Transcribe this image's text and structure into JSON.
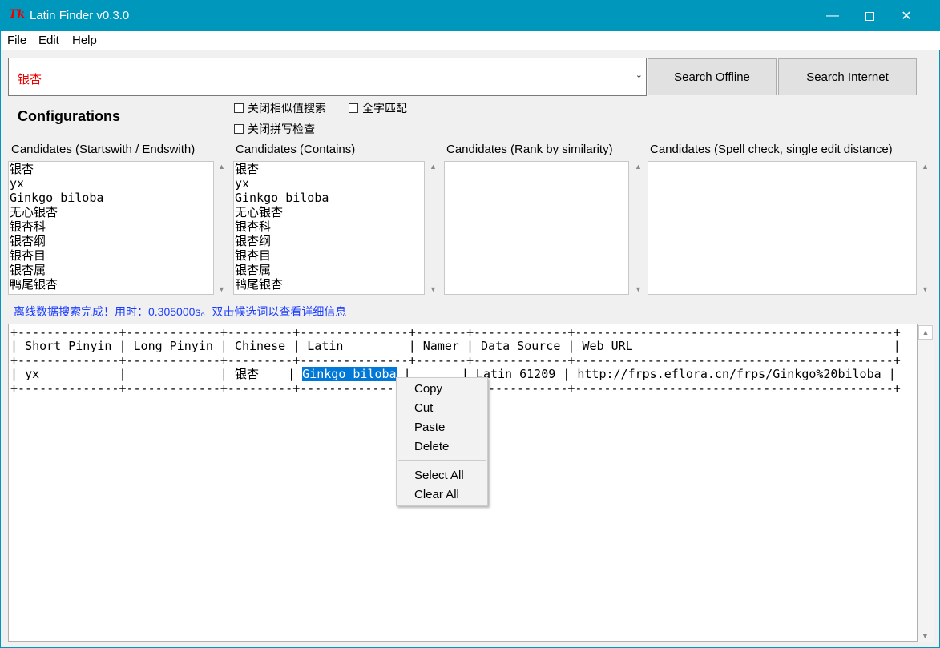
{
  "window": {
    "title": "Latin Finder v0.3.0",
    "logo": "Tk",
    "controls": [
      "minimize-icon",
      "maximize-icon",
      "close-icon"
    ]
  },
  "menubar": [
    "File",
    "Edit",
    "Help"
  ],
  "search": {
    "value": "银杏",
    "search_offline": "Search Offline",
    "search_internet": "Search Internet"
  },
  "config": {
    "title": "Configurations",
    "options": [
      {
        "label": "关闭相似值搜索",
        "checked": false
      },
      {
        "label": "全字匹配",
        "checked": false
      },
      {
        "label": "关闭拼写检查",
        "checked": false
      }
    ]
  },
  "candidates": [
    {
      "label": "Candidates (Startswith / Endswith)",
      "items": [
        "银杏",
        "yx",
        "Ginkgo biloba",
        "无心银杏",
        "银杏科",
        "银杏纲",
        "银杏目",
        "银杏属",
        "鸭尾银杏"
      ]
    },
    {
      "label": "Candidates (Contains)",
      "items": [
        "银杏",
        "yx",
        "Ginkgo biloba",
        "无心银杏",
        "银杏科",
        "银杏纲",
        "银杏目",
        "银杏属",
        "鸭尾银杏"
      ]
    },
    {
      "label": "Candidates (Rank by similarity)",
      "items": []
    },
    {
      "label": "Candidates (Spell check, single edit distance)",
      "items": []
    }
  ],
  "status": "离线数据搜索完成！用时：0.305000s。双击候选词以查看详细信息",
  "results": {
    "headers": [
      "Short Pinyin",
      "Long Pinyin",
      "Chinese",
      "Latin",
      "Namer",
      "Data Source",
      "Web URL"
    ],
    "rows": [
      [
        "yx",
        "",
        "银杏",
        "Ginkgo biloba",
        "",
        "Latin 61209",
        "http://frps.eflora.cn/frps/Ginkgo%20biloba"
      ]
    ],
    "selected_text": "Ginkgo biloba"
  },
  "context_menu": [
    "Copy",
    "Cut",
    "Paste",
    "Delete",
    "Select All",
    "Clear All"
  ]
}
